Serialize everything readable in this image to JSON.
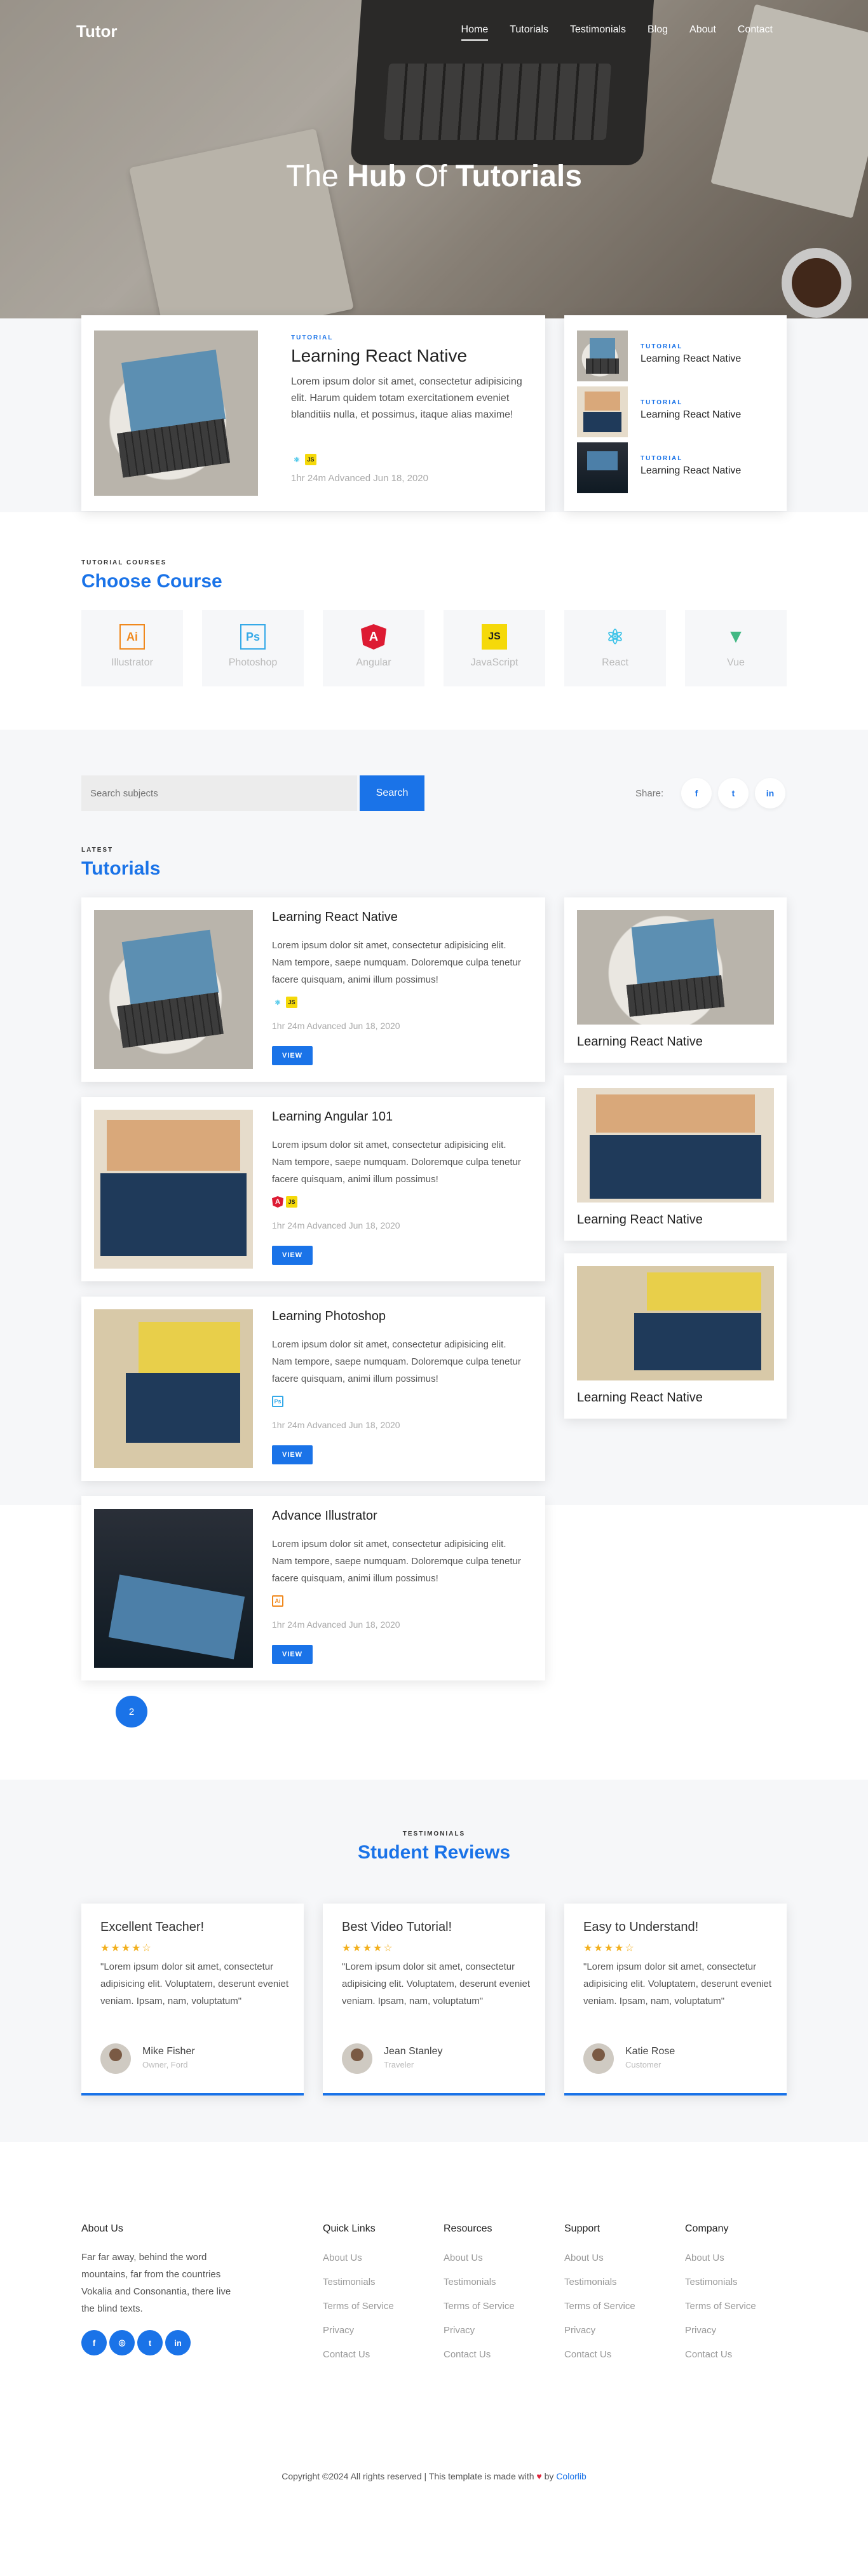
{
  "brand": {
    "name": "Tutor",
    "accent": "#1a73e8"
  },
  "nav": {
    "items": [
      "Home",
      "Tutorials",
      "Testimonials",
      "Blog",
      "About",
      "Contact"
    ]
  },
  "hero": {
    "title_pre": "The ",
    "title_bold1": "Hub",
    "title_mid": " Of ",
    "title_bold2": "Tutorials"
  },
  "featured": {
    "eyebrow": "TUTORIAL",
    "title": "Learning React Native",
    "text": "Lorem ipsum dolor sit amet, consectetur adipisicing elit. Harum quidem totam exercitationem eveniet blanditiis nulla, et possimus, itaque alias maxime!",
    "meta": "1hr 24m   Advanced   Jun 18, 2020"
  },
  "side_featured": [
    {
      "eyebrow": "TUTORIAL",
      "title": "Learning React Native"
    },
    {
      "eyebrow": "TUTORIAL",
      "title": "Learning React Native"
    },
    {
      "eyebrow": "TUTORIAL",
      "title": "Learning React Native"
    }
  ],
  "courses": {
    "eyebrow": "TUTORIAL COURSES",
    "title": "Choose Course",
    "items": [
      {
        "label": "Illustrator",
        "icon": "illustrator-icon",
        "glyph": "Ai",
        "color": "#f0881c"
      },
      {
        "label": "Photoshop",
        "icon": "photoshop-icon",
        "glyph": "Ps",
        "color": "#34a9e8"
      },
      {
        "label": "Angular",
        "icon": "angular-icon",
        "glyph": "A",
        "color": "#dd1b33"
      },
      {
        "label": "JavaScript",
        "icon": "javascript-icon",
        "glyph": "JS",
        "color": "#f5d90a"
      },
      {
        "label": "React",
        "icon": "react-icon",
        "glyph": "⚛",
        "color": "#3fc3e8"
      },
      {
        "label": "Vue",
        "icon": "vue-icon",
        "glyph": "▼",
        "color": "#41b883"
      }
    ]
  },
  "search": {
    "placeholder": "Search subjects",
    "button": "Search",
    "share_label": "Share:",
    "social": [
      "f",
      "t",
      "in"
    ]
  },
  "latest": {
    "eyebrow": "LATEST",
    "title": "Tutorials",
    "items": [
      {
        "title": "Learning React Native",
        "text": "Lorem ipsum dolor sit amet, consectetur adipisicing elit. Nam tempore, saepe numquam. Doloremque culpa tenetur facere quisquam, animi illum possimus!",
        "meta": "1hr 24m   Advanced   Jun 18, 2020",
        "button": "VIEW"
      },
      {
        "title": "Learning Angular 101",
        "text": "Lorem ipsum dolor sit amet, consectetur adipisicing elit. Nam tempore, saepe numquam. Doloremque culpa tenetur facere quisquam, animi illum possimus!",
        "meta": "1hr 24m   Advanced   Jun 18, 2020",
        "button": "VIEW"
      },
      {
        "title": "Learning Photoshop",
        "text": "Lorem ipsum dolor sit amet, consectetur adipisicing elit. Nam tempore, saepe numquam. Doloremque culpa tenetur facere quisquam, animi illum possimus!",
        "meta": "1hr 24m   Advanced   Jun 18, 2020",
        "button": "VIEW"
      },
      {
        "title": "Advance Illustrator",
        "text": "Lorem ipsum dolor sit amet, consectetur adipisicing elit. Nam tempore, saepe numquam. Doloremque culpa tenetur facere quisquam, animi illum possimus!",
        "meta": "1hr 24m   Advanced   Jun 18, 2020",
        "button": "VIEW"
      }
    ],
    "side": [
      {
        "title": "Learning React Native"
      },
      {
        "title": "Learning React Native"
      },
      {
        "title": "Learning React Native"
      }
    ]
  },
  "pagination": {
    "pages": [
      "",
      "2",
      "",
      "",
      ""
    ],
    "active": "2"
  },
  "testimonials": {
    "eyebrow": "TESTIMONIALS",
    "title": "Student Reviews",
    "items": [
      {
        "title": "Excellent Teacher!",
        "stars": "★★★★☆",
        "quote": "\"Lorem ipsum dolor sit amet, consectetur adipisicing elit. Voluptatem, deserunt eveniet veniam. Ipsam, nam, voluptatum\"",
        "name": "Mike Fisher",
        "role": "Owner, Ford"
      },
      {
        "title": "Best Video Tutorial!",
        "stars": "★★★★☆",
        "quote": "\"Lorem ipsum dolor sit amet, consectetur adipisicing elit. Voluptatem, deserunt eveniet veniam. Ipsam, nam, voluptatum\"",
        "name": "Jean Stanley",
        "role": "Traveler"
      },
      {
        "title": "Easy to Understand!",
        "stars": "★★★★☆",
        "quote": "\"Lorem ipsum dolor sit amet, consectetur adipisicing elit. Voluptatem, deserunt eveniet veniam. Ipsam, nam, voluptatum\"",
        "name": "Katie Rose",
        "role": "Customer"
      }
    ]
  },
  "footer": {
    "about_title": "About Us",
    "about_text": "Far far away, behind the word mountains, far from the countries Vokalia and Consonantia, there live the blind texts.",
    "social": [
      "f",
      "◎",
      "t",
      "in"
    ],
    "columns": [
      {
        "title": "Quick Links",
        "links": [
          "About Us",
          "Testimonials",
          "Terms of Service",
          "Privacy",
          "Contact Us"
        ]
      },
      {
        "title": "Resources",
        "links": [
          "About Us",
          "Testimonials",
          "Terms of Service",
          "Privacy",
          "Contact Us"
        ]
      },
      {
        "title": "Support",
        "links": [
          "About Us",
          "Testimonials",
          "Terms of Service",
          "Privacy",
          "Contact Us"
        ]
      },
      {
        "title": "Company",
        "links": [
          "About Us",
          "Testimonials",
          "Terms of Service",
          "Privacy",
          "Contact Us"
        ]
      }
    ],
    "copyright_pre": "Copyright ©2024 All rights reserved | This template is made with",
    "copyright_by": " by ",
    "copyright_link": "Colorlib"
  }
}
